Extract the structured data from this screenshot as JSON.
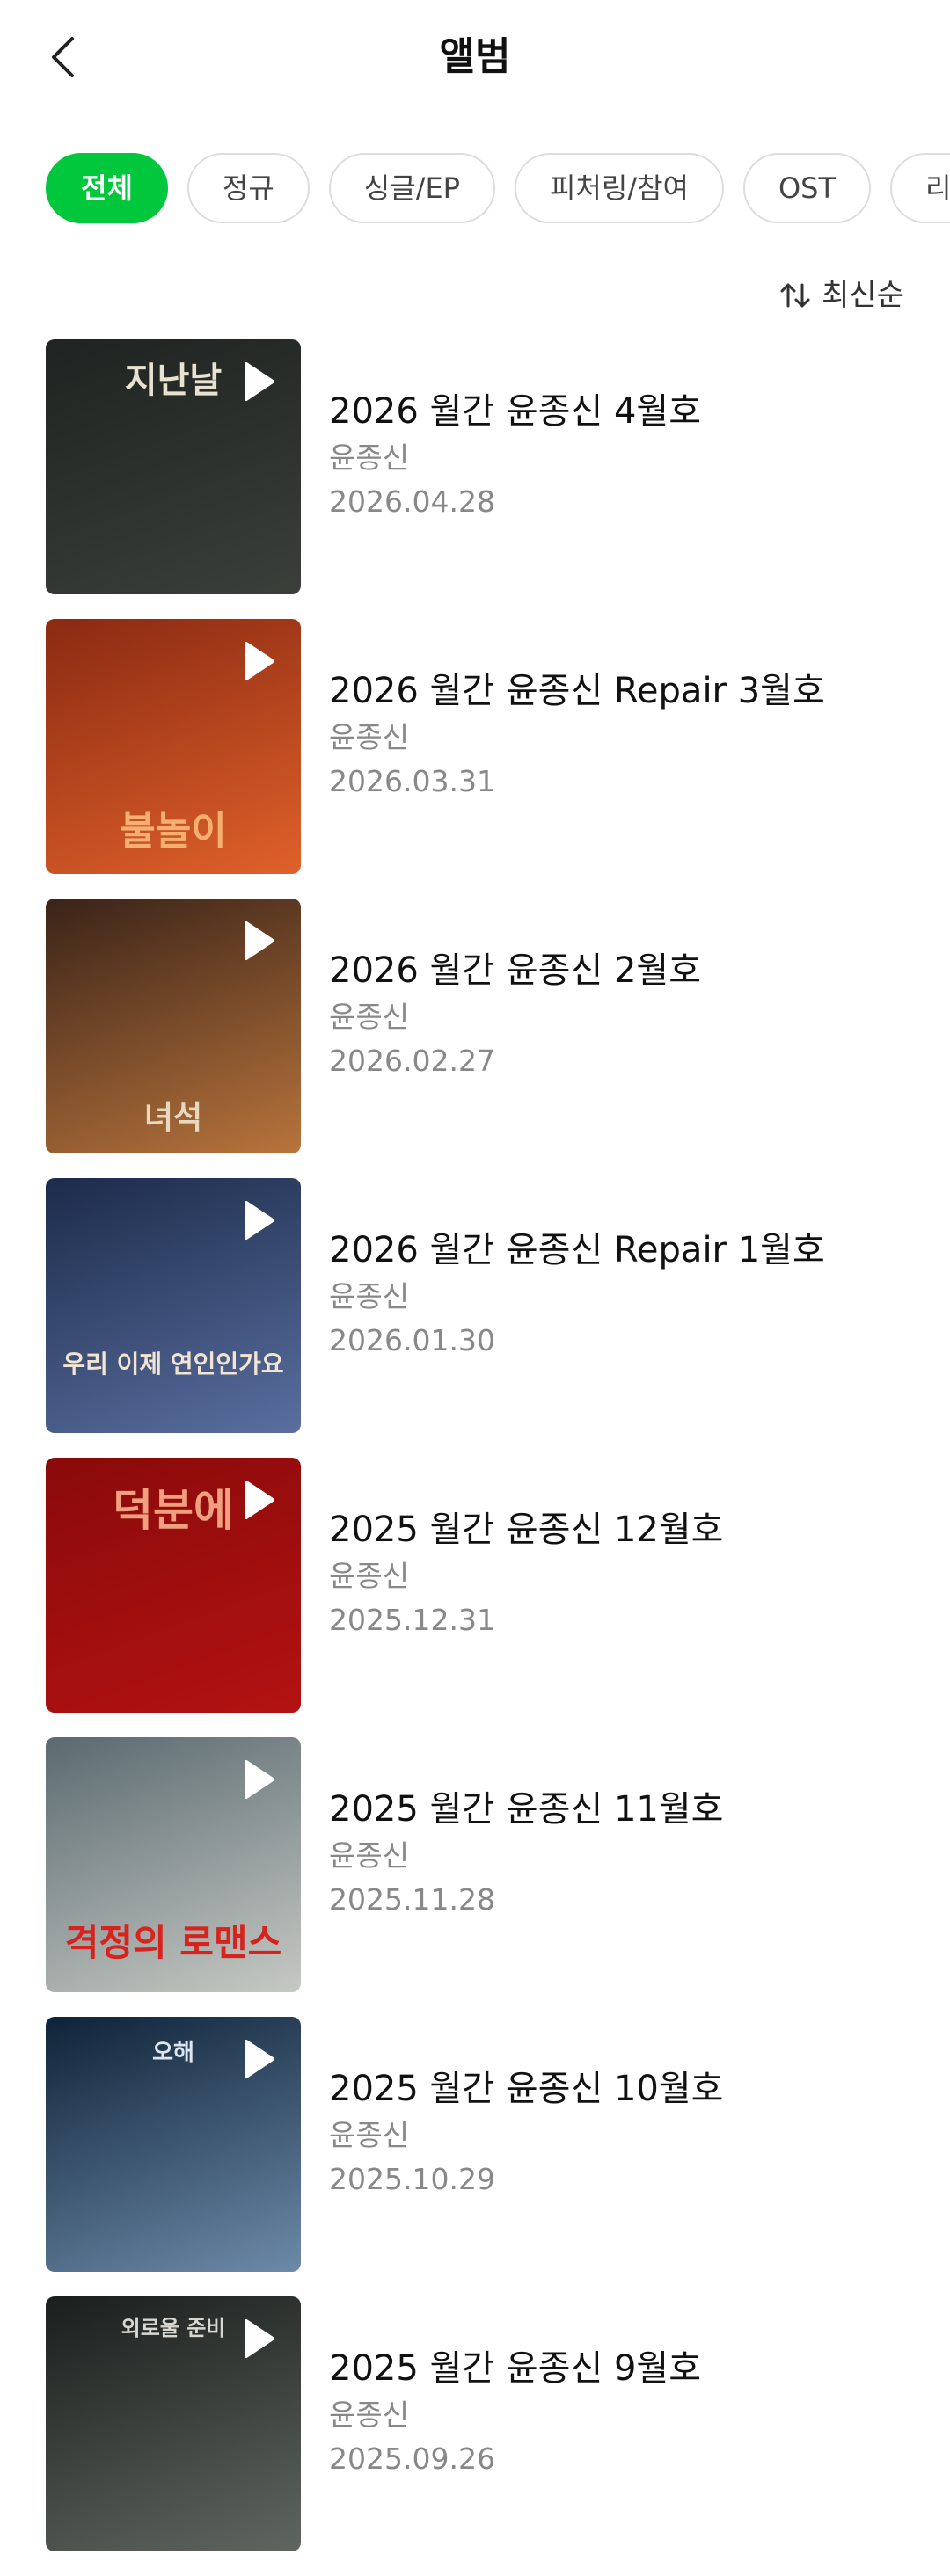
{
  "header": {
    "title": "앨범",
    "back_icon": "chevron-left-icon"
  },
  "filters": [
    {
      "label": "전체",
      "active": true
    },
    {
      "label": "정규",
      "active": false
    },
    {
      "label": "싱글/EP",
      "active": false
    },
    {
      "label": "피처링/참여",
      "active": false
    },
    {
      "label": "OST",
      "active": false
    },
    {
      "label": "리",
      "active": false
    }
  ],
  "sort": {
    "label": "최신순",
    "icon": "sort-arrows-icon"
  },
  "accent_color": "#00c73c",
  "albums": [
    {
      "title": "2026 월간 윤종신 4월호",
      "artist": "윤종신",
      "date": "2026.04.28",
      "cover_text": "지난날",
      "cover_colors": [
        "#1f2321",
        "#3b3f3a"
      ]
    },
    {
      "title": "2026 월간 윤종신 Repair 3월호",
      "artist": "윤종신",
      "date": "2026.03.31",
      "cover_text": "불놀이",
      "cover_colors": [
        "#8a2a12",
        "#e0612a"
      ]
    },
    {
      "title": "2026 월간 윤종신 2월호",
      "artist": "윤종신",
      "date": "2026.02.27",
      "cover_text": "녀석",
      "cover_colors": [
        "#3a2318",
        "#b8743c"
      ]
    },
    {
      "title": "2026 월간 윤종신 Repair 1월호",
      "artist": "윤종신",
      "date": "2026.01.30",
      "cover_text": "우리 이제 연인인가요",
      "cover_colors": [
        "#1c2b4a",
        "#5a6fa0"
      ]
    },
    {
      "title": "2025 월간 윤종신 12월호",
      "artist": "윤종신",
      "date": "2025.12.31",
      "cover_text": "덕분에",
      "cover_colors": [
        "#8a0a0a",
        "#b31212"
      ]
    },
    {
      "title": "2025 월간 윤종신 11월호",
      "artist": "윤종신",
      "date": "2025.11.28",
      "cover_text": "격정의 로맨스",
      "cover_colors": [
        "#5b6a70",
        "#c6c9c4"
      ]
    },
    {
      "title": "2025 월간 윤종신 10월호",
      "artist": "윤종신",
      "date": "2025.10.29",
      "cover_text": "오해",
      "cover_colors": [
        "#0f2338",
        "#6c8aa8"
      ]
    },
    {
      "title": "2025 월간 윤종신 9월호",
      "artist": "윤종신",
      "date": "2025.09.26",
      "cover_text": "외로울 준비",
      "cover_colors": [
        "#1a1e1d",
        "#5f6660"
      ]
    }
  ]
}
